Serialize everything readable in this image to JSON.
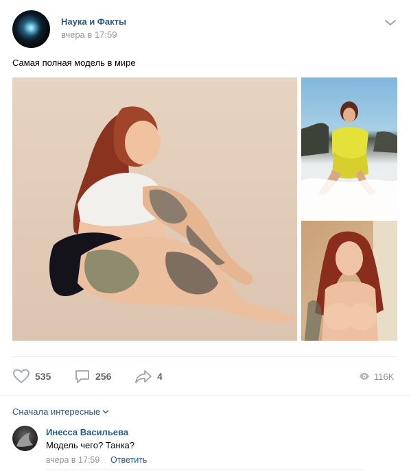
{
  "post": {
    "author": "Наука и Факты",
    "time": "вчера в 17:59",
    "text": "Самая полная модель в мире",
    "photos": [
      {
        "name": "main-photo"
      },
      {
        "name": "beach-photo"
      },
      {
        "name": "portrait-photo"
      }
    ]
  },
  "actions": {
    "likes": "535",
    "comments": "256",
    "shares": "4",
    "views": "116K"
  },
  "comments_section": {
    "sort_label": "Сначала интересные",
    "items": [
      {
        "author": "Инесса Васильева",
        "text": "Модель чего? Танка?",
        "time": "вчера в 17:59",
        "reply_label": "Ответить"
      }
    ]
  },
  "colors": {
    "link": "#2a5885",
    "muted": "#939393",
    "icon": "#99a2ad",
    "divider": "#e7e8ec"
  },
  "icons": [
    "menu-chevron-icon",
    "heart-icon",
    "comment-icon",
    "share-icon",
    "eye-icon",
    "chevron-down-icon"
  ]
}
